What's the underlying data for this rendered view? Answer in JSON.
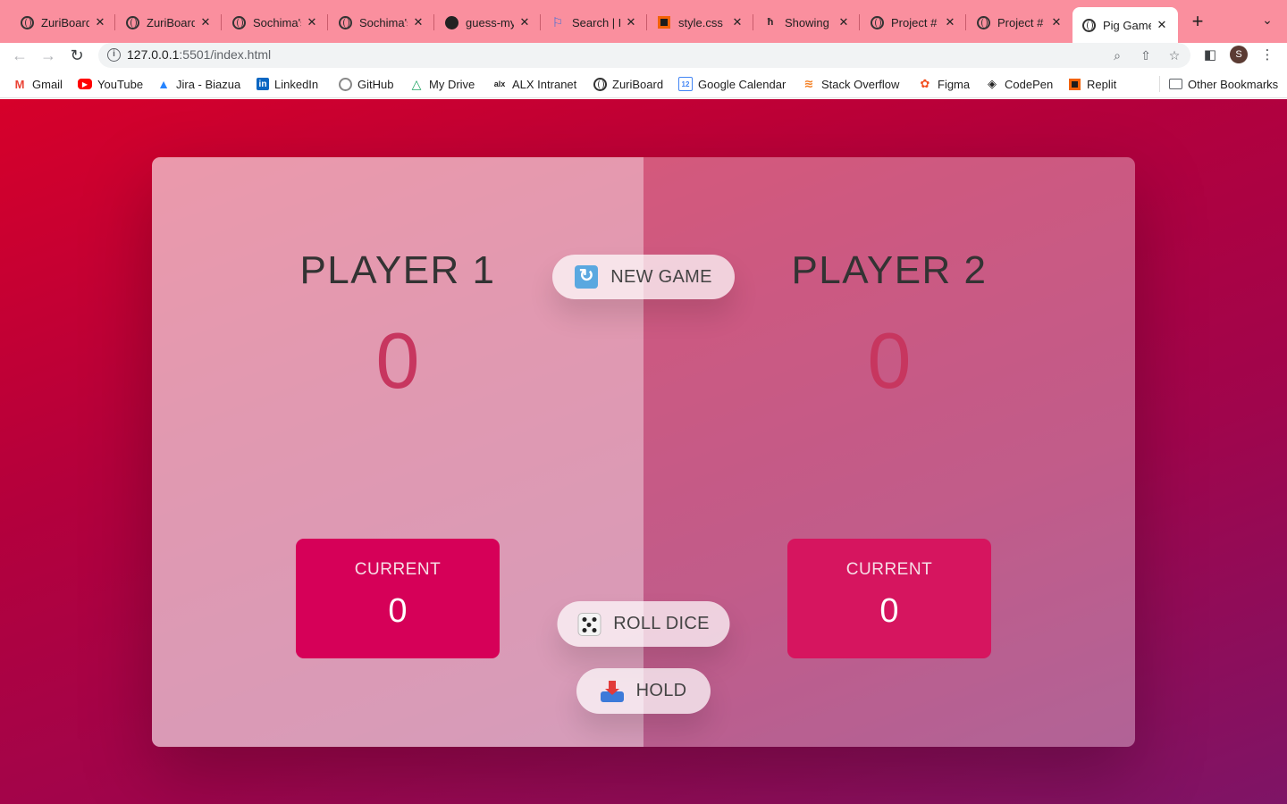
{
  "browser": {
    "tabs": [
      {
        "title": "ZuriBoard",
        "icon": "globe-icon"
      },
      {
        "title": "ZuriBoard",
        "icon": "globe-icon"
      },
      {
        "title": "Sochima's",
        "icon": "globe-icon"
      },
      {
        "title": "Sochima's",
        "icon": "globe-icon"
      },
      {
        "title": "guess-my",
        "icon": "github-icon"
      },
      {
        "title": "Search | F",
        "icon": "flag-icon"
      },
      {
        "title": "style.css",
        "icon": "replit-icon"
      },
      {
        "title": "Showing",
        "icon": "netlify-icon"
      },
      {
        "title": "Project #",
        "icon": "globe-icon"
      },
      {
        "title": "Project #",
        "icon": "globe-icon"
      },
      {
        "title": "Pig Game",
        "icon": "globe-icon",
        "active": true
      }
    ],
    "new_tab_glyph": "+",
    "url_host": "127.0.0.1",
    "url_rest": ":5501/index.html",
    "profile_initial": "S",
    "bookmarks": [
      {
        "label": "Gmail",
        "icon": "gmail-icon"
      },
      {
        "label": "YouTube",
        "icon": "youtube-icon"
      },
      {
        "label": "Jira - Biazua",
        "icon": "jira-icon"
      },
      {
        "label": "LinkedIn",
        "icon": "linkedin-icon"
      },
      {
        "label": "GitHub",
        "icon": "github-icon"
      },
      {
        "label": "My Drive",
        "icon": "drive-icon"
      },
      {
        "label": "ALX Intranet",
        "icon": "alx-icon"
      },
      {
        "label": "ZuriBoard",
        "icon": "globe-icon"
      },
      {
        "label": "Google Calendar",
        "icon": "calendar-icon"
      },
      {
        "label": "Stack Overflow",
        "icon": "stackoverflow-icon"
      },
      {
        "label": "Figma",
        "icon": "figma-icon"
      },
      {
        "label": "CodePen",
        "icon": "codepen-icon"
      },
      {
        "label": "Replit",
        "icon": "replit-icon"
      }
    ],
    "other_bookmarks": "Other Bookmarks"
  },
  "game": {
    "new_game_label": "NEW GAME",
    "roll_dice_label": "ROLL DICE",
    "hold_label": "HOLD",
    "players": [
      {
        "name": "PLAYER 1",
        "score": "0",
        "current_label": "CURRENT",
        "current_score": "0"
      },
      {
        "name": "PLAYER 2",
        "score": "0",
        "current_label": "CURRENT",
        "current_score": "0"
      }
    ]
  },
  "colors": {
    "tab_strip": "#fa8f9e",
    "score": "#c7365f",
    "current_box": "#d60058"
  }
}
